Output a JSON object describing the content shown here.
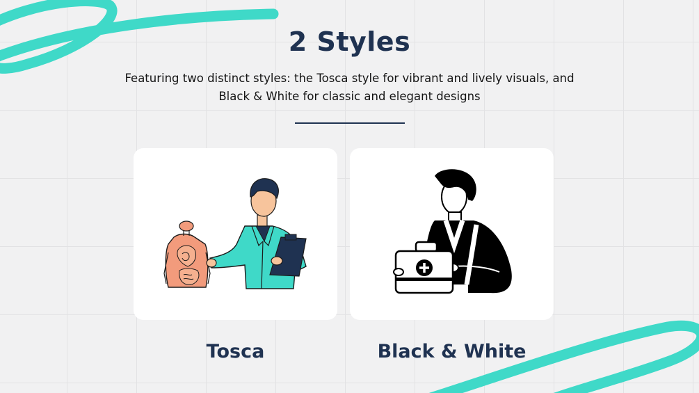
{
  "heading": "2 Styles",
  "description": "Featuring two distinct styles: the Tosca style for vibrant and lively visuals, and Black & White for classic and elegant designs",
  "styles": [
    {
      "label": "Tosca",
      "illustration": "doctor-with-anatomy-model"
    },
    {
      "label": "Black & White",
      "illustration": "medic-with-first-aid-kit"
    }
  ],
  "colors": {
    "accent": "#3fd9c8",
    "title": "#1f3251",
    "skin": "#f7c49c",
    "organ": "#f29b7c"
  }
}
